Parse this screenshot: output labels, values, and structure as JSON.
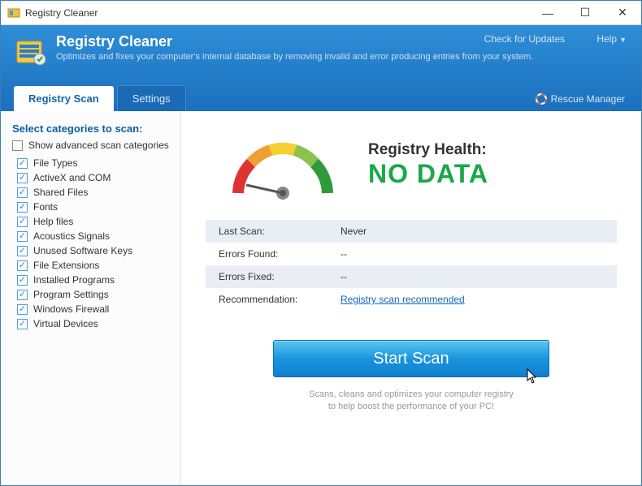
{
  "window": {
    "title": "Registry Cleaner"
  },
  "header": {
    "title": "Registry Cleaner",
    "subtitle": "Optimizes and fixes your computer's internal database by removing invalid and error producing entries from your system.",
    "check_updates": "Check for Updates",
    "help": "Help"
  },
  "tabs": {
    "scan": "Registry Scan",
    "settings": "Settings",
    "rescue": "Rescue Manager"
  },
  "sidebar": {
    "title": "Select categories to scan:",
    "show_advanced": "Show advanced scan categories",
    "items": [
      "File Types",
      "ActiveX and COM",
      "Shared Files",
      "Fonts",
      "Help files",
      "Acoustics Signals",
      "Unused Software Keys",
      "File Extensions",
      "Installed Programs",
      "Program Settings",
      "Windows Firewall",
      "Virtual Devices"
    ]
  },
  "health": {
    "title": "Registry Health:",
    "value": "NO DATA"
  },
  "stats": {
    "last_scan_label": "Last Scan:",
    "last_scan_value": "Never",
    "errors_found_label": "Errors Found:",
    "errors_found_value": "--",
    "errors_fixed_label": "Errors Fixed:",
    "errors_fixed_value": "--",
    "recommendation_label": "Recommendation:",
    "recommendation_value": "Registry scan recommended"
  },
  "scan": {
    "button": "Start Scan",
    "footnote1": "Scans, cleans and optimizes your computer registry",
    "footnote2": "to help boost the performance of your PC!"
  }
}
